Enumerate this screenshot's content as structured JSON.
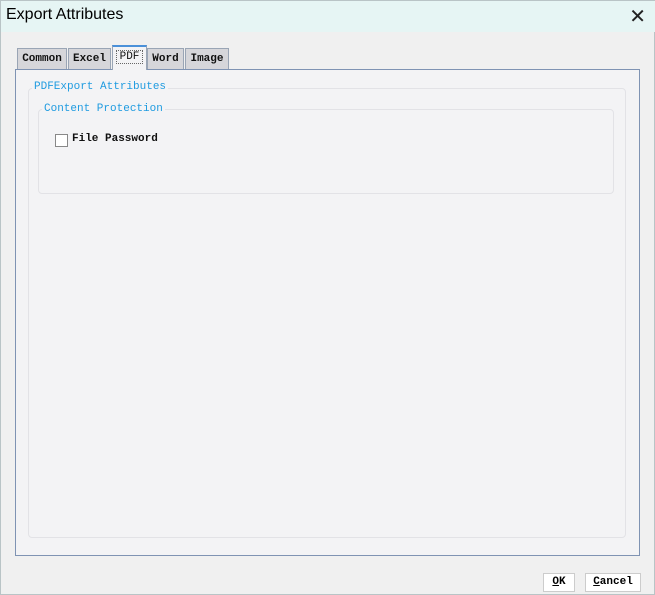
{
  "window": {
    "title": "Export Attributes",
    "close_icon": "close-icon"
  },
  "tabs": [
    {
      "label": "Common"
    },
    {
      "label": "Excel"
    },
    {
      "label": "PDF",
      "active": true
    },
    {
      "label": "Word"
    },
    {
      "label": "Image"
    }
  ],
  "pdf": {
    "group_title": "PDFExport Attributes",
    "protection_title": "Content Protection",
    "file_password_label": "File Password",
    "file_password_checked": false
  },
  "buttons": {
    "ok_mnemonic": "O",
    "ok_rest": "K",
    "cancel_mnemonic": "C",
    "cancel_rest": "ancel"
  }
}
